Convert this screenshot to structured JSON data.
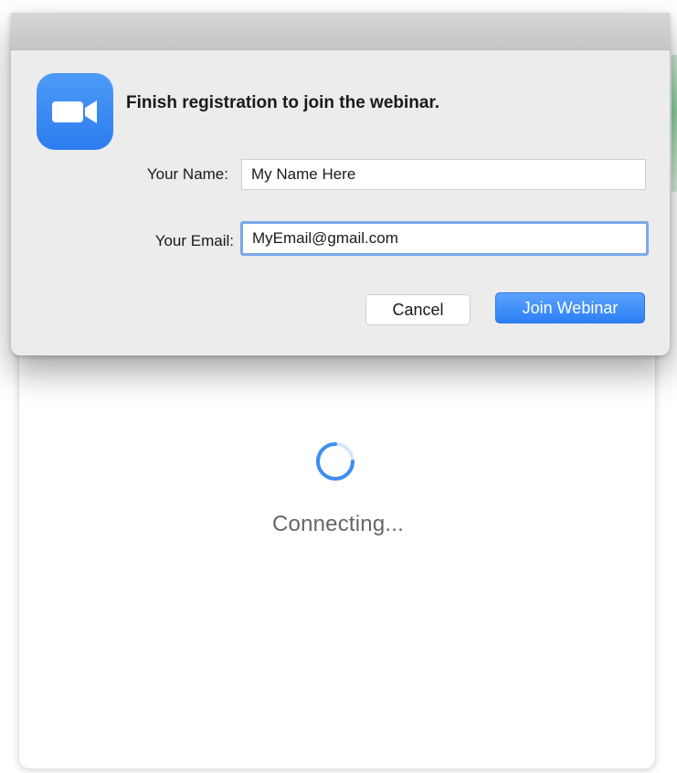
{
  "dialog": {
    "title": "Finish registration to join the webinar.",
    "name_label": "Your Name:",
    "name_value": "My Name Here",
    "email_label": "Your Email:",
    "email_value": "MyEmail@gmail.com",
    "cancel_label": "Cancel",
    "join_label": "Join Webinar",
    "app_icon": "zoom-camera-icon"
  },
  "main_window": {
    "status_text": "Connecting...",
    "spinner_icon": "loading-spinner-icon"
  },
  "colors": {
    "accent": "#2c7ff5",
    "icon_bg": "#3a8cf3",
    "dialog_bg": "#ececec"
  }
}
